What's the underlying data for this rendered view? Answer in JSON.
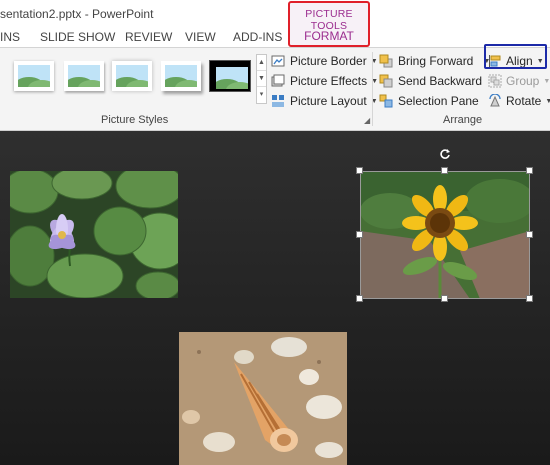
{
  "window": {
    "title": "sentation2.pptx - PowerPoint"
  },
  "contextual": {
    "title": "PICTURE TOOLS",
    "tab": "FORMAT"
  },
  "tabs": [
    "INS",
    "SLIDE SHOW",
    "REVIEW",
    "VIEW",
    "ADD-INS"
  ],
  "picture_styles": {
    "thumbnails": [
      "simple-frame-white",
      "drop-shadow-rectangle",
      "soft-edge-rectangle",
      "reflected-rectangle",
      "simple-frame-black"
    ],
    "selected_index": 4,
    "commands": [
      {
        "label": "Picture Border",
        "icon": "picture-border-icon"
      },
      {
        "label": "Picture Effects",
        "icon": "picture-effects-icon"
      },
      {
        "label": "Picture Layout",
        "icon": "picture-layout-icon"
      }
    ],
    "group_label": "Picture Styles"
  },
  "arrange": {
    "commands": [
      {
        "label": "Bring Forward",
        "icon": "bring-forward-icon"
      },
      {
        "label": "Send Backward",
        "icon": "send-backward-icon"
      },
      {
        "label": "Selection Pane",
        "icon": "selection-pane-icon"
      }
    ],
    "commands_right": [
      {
        "label": "Align",
        "icon": "align-icon"
      },
      {
        "label": "Group",
        "icon": "group-icon",
        "disabled": true
      },
      {
        "label": "Rotate",
        "icon": "rotate-icon"
      }
    ],
    "group_label": "Arrange"
  },
  "slide": {
    "pictures": [
      "water-lily",
      "sunflower",
      "seashells"
    ],
    "selected_picture": "sunflower"
  },
  "colors": {
    "contextual_accent": "#9b2d8f",
    "contextual_highlight_box": "#e0202a",
    "align_highlight_box": "#1c2aa8",
    "slide_background": "#262626"
  }
}
